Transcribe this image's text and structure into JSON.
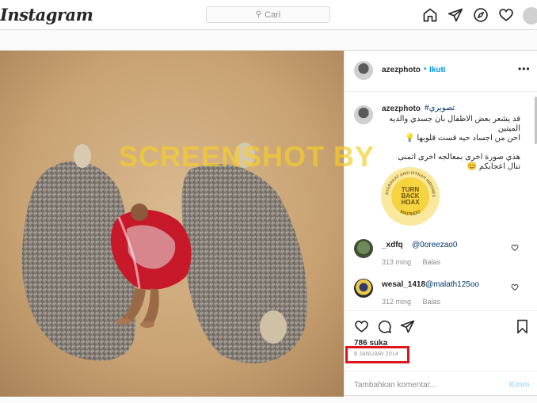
{
  "nav": {
    "logo": "Instagram",
    "search_placeholder": "Cari",
    "icons": [
      "home-icon",
      "direct-icon",
      "explore-icon",
      "activity-heart-icon",
      "profile-avatar"
    ]
  },
  "post": {
    "author": "azezphoto",
    "follow_label": "Ikuti",
    "more_label": "•••",
    "caption": {
      "hashtag": "#تصويري",
      "lines": [
        "قد يشعر بعض الاطفال بان جسدي والديه",
        "الميتين",
        "احن من اجساد حيه قست قلوبها 💡"
      ],
      "lines2": [
        "هذي صورة اخرى بمعالجه اخرى اتمنى",
        "تنال اعجابكم 😊"
      ]
    },
    "comments": [
      {
        "user": "_xdfq",
        "mention": "@0oreezao0",
        "time": "313 ming",
        "reply": "Balas"
      },
      {
        "user": "wesal_1418",
        "mention": "@malath125oo",
        "time": "312 ming",
        "reply": "Balas"
      }
    ],
    "likes": "786 suka",
    "date": "8 JANUARI 2014",
    "add_comment_placeholder": "Tambahkan komentar...",
    "post_button": "Kirim"
  },
  "watermark": {
    "text": "SCREENSHOT BY",
    "seal_top": "MASYARAKAT ANTI FITNAH INDONESIA",
    "seal_center": [
      "TURN",
      "BACK",
      "HOAX"
    ],
    "seal_bottom": "MAFINDO"
  },
  "colors": {
    "accent_blue": "#0095f6",
    "mention_blue": "#00376b",
    "highlight_red": "#e0141b",
    "watermark_yellow": "#f5cd28"
  }
}
